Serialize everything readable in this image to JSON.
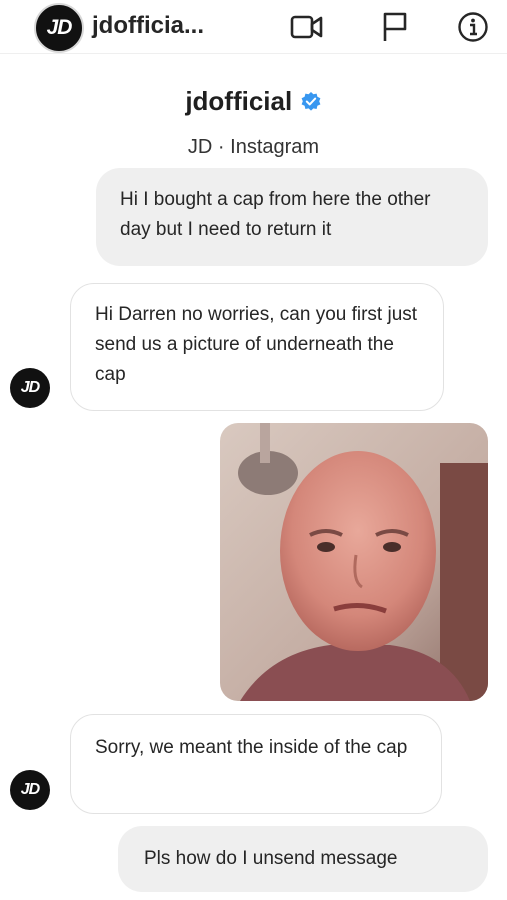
{
  "header": {
    "username_truncated": "jdofficia...",
    "avatar_icon": "jd-logo-icon",
    "avatar_text": "JD",
    "icons": [
      "video-call-icon",
      "flag-icon",
      "info-icon"
    ]
  },
  "profile": {
    "name": "jdofficial",
    "verified": true,
    "verified_color": "#3897f0",
    "subtitle": "JD · Instagram"
  },
  "messages": [
    {
      "direction": "outgoing",
      "text": "Hi I bought a cap from here the other day but I need to return it"
    },
    {
      "direction": "incoming",
      "text": "Hi Darren no worries, can you first just send us a picture of underneath the cap"
    },
    {
      "direction": "outgoing",
      "type": "photo",
      "icon": "photo-message"
    },
    {
      "direction": "incoming",
      "text": "Sorry, we meant the inside of the cap"
    },
    {
      "direction": "outgoing",
      "text": "Pls how do I unsend message"
    }
  ],
  "colors": {
    "outgoing_bubble": "#efefef",
    "incoming_bubble": "#ffffff",
    "text": "#262626"
  }
}
